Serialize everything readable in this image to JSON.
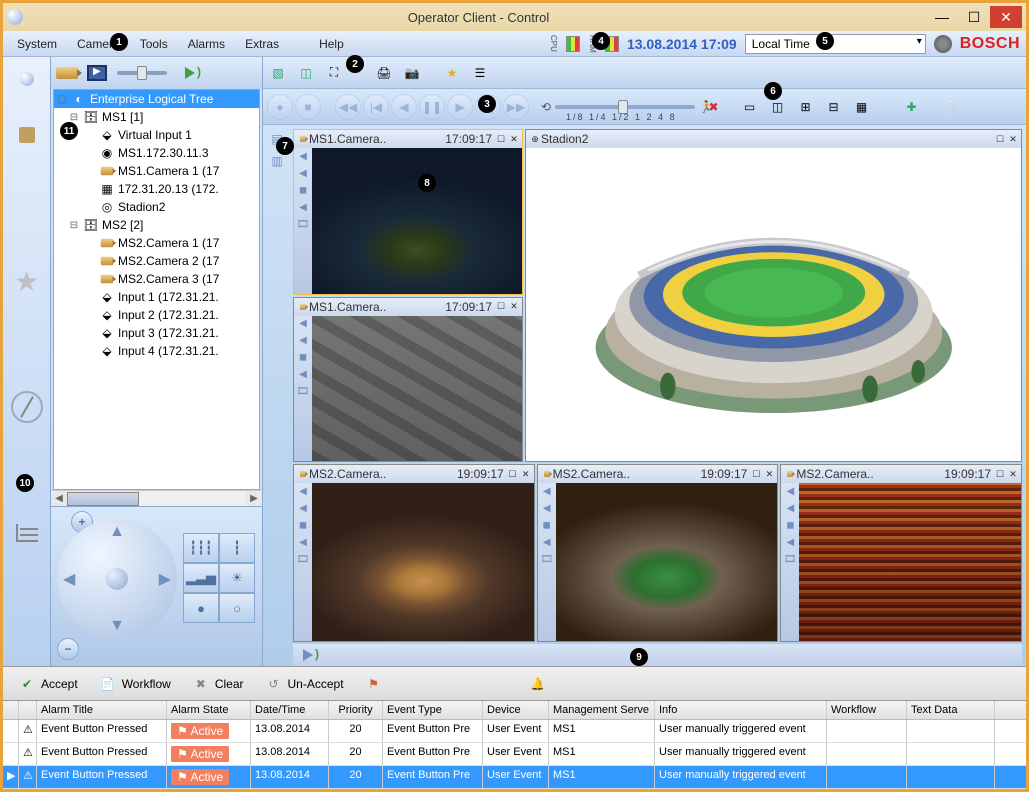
{
  "window": {
    "title": "Operator Client - Control"
  },
  "menu": {
    "items": [
      "System",
      "Camera",
      "Tools",
      "Alarms",
      "Extras",
      "Help"
    ]
  },
  "header": {
    "cpu_label": "CPU",
    "ram_label": "RAM",
    "datetime": "13.08.2014 17:09",
    "timezone": "Local Time",
    "brand": "BOSCH"
  },
  "tree": {
    "root": {
      "label": "Enterprise Logical Tree"
    },
    "ms1": {
      "label": "MS1 [1]"
    },
    "ms1_children": [
      "Virtual Input 1",
      "MS1.172.30.11.3",
      "MS1.Camera 1 (17",
      "172.31.20.13 (172.",
      "Stadion2"
    ],
    "ms2": {
      "label": "MS2 [2]"
    },
    "ms2_children": [
      "MS2.Camera 1 (17",
      "MS2.Camera 2 (17",
      "MS2.Camera 3 (17",
      "Input 1 (172.31.21.",
      "Input 2 (172.31.21.",
      "Input 3 (172.31.21.",
      "Input 4 (172.31.21."
    ]
  },
  "speed": {
    "ticks": "1/8 1/4 1/2  1  2  4  8"
  },
  "cameras": {
    "c1": {
      "name": "MS1.Camera..",
      "time": "17:09:17"
    },
    "c2": {
      "name": "MS1.Camera..",
      "time": "17:09:17"
    },
    "c3": {
      "name": "MS2.Camera..",
      "time": "19:09:17"
    },
    "c4": {
      "name": "MS2.Camera..",
      "time": "19:09:17"
    },
    "c5": {
      "name": "MS2.Camera..",
      "time": "19:09:17"
    },
    "map": {
      "name": "Stadion2"
    }
  },
  "alarm_buttons": {
    "accept": "Accept",
    "workflow": "Workflow",
    "clear": "Clear",
    "unaccept": "Un-Accept"
  },
  "alarm_headers": {
    "title": "Alarm Title",
    "state": "Alarm State",
    "datetime": "Date/Time",
    "priority": "Priority",
    "eventtype": "Event Type",
    "device": "Device",
    "mgmt": "Management Serve",
    "info": "Info",
    "workflow": "Workflow",
    "textdata": "Text Data"
  },
  "alarms": [
    {
      "title": "Event Button Pressed",
      "state": "Active",
      "dt": "13.08.2014",
      "pri": "20",
      "evt": "Event Button Pre",
      "dev": "User Event",
      "ms": "MS1",
      "info": "User manually triggered event"
    },
    {
      "title": "Event Button Pressed",
      "state": "Active",
      "dt": "13.08.2014",
      "pri": "20",
      "evt": "Event Button Pre",
      "dev": "User Event",
      "ms": "MS1",
      "info": "User manually triggered event"
    },
    {
      "title": "Event Button Pressed",
      "state": "Active",
      "dt": "13.08.2014",
      "pri": "20",
      "evt": "Event Button Pre",
      "dev": "User Event",
      "ms": "MS1",
      "info": "User manually triggered event"
    }
  ],
  "badges": [
    "1",
    "2",
    "3",
    "4",
    "5",
    "6",
    "7",
    "8",
    "9",
    "10",
    "11"
  ]
}
